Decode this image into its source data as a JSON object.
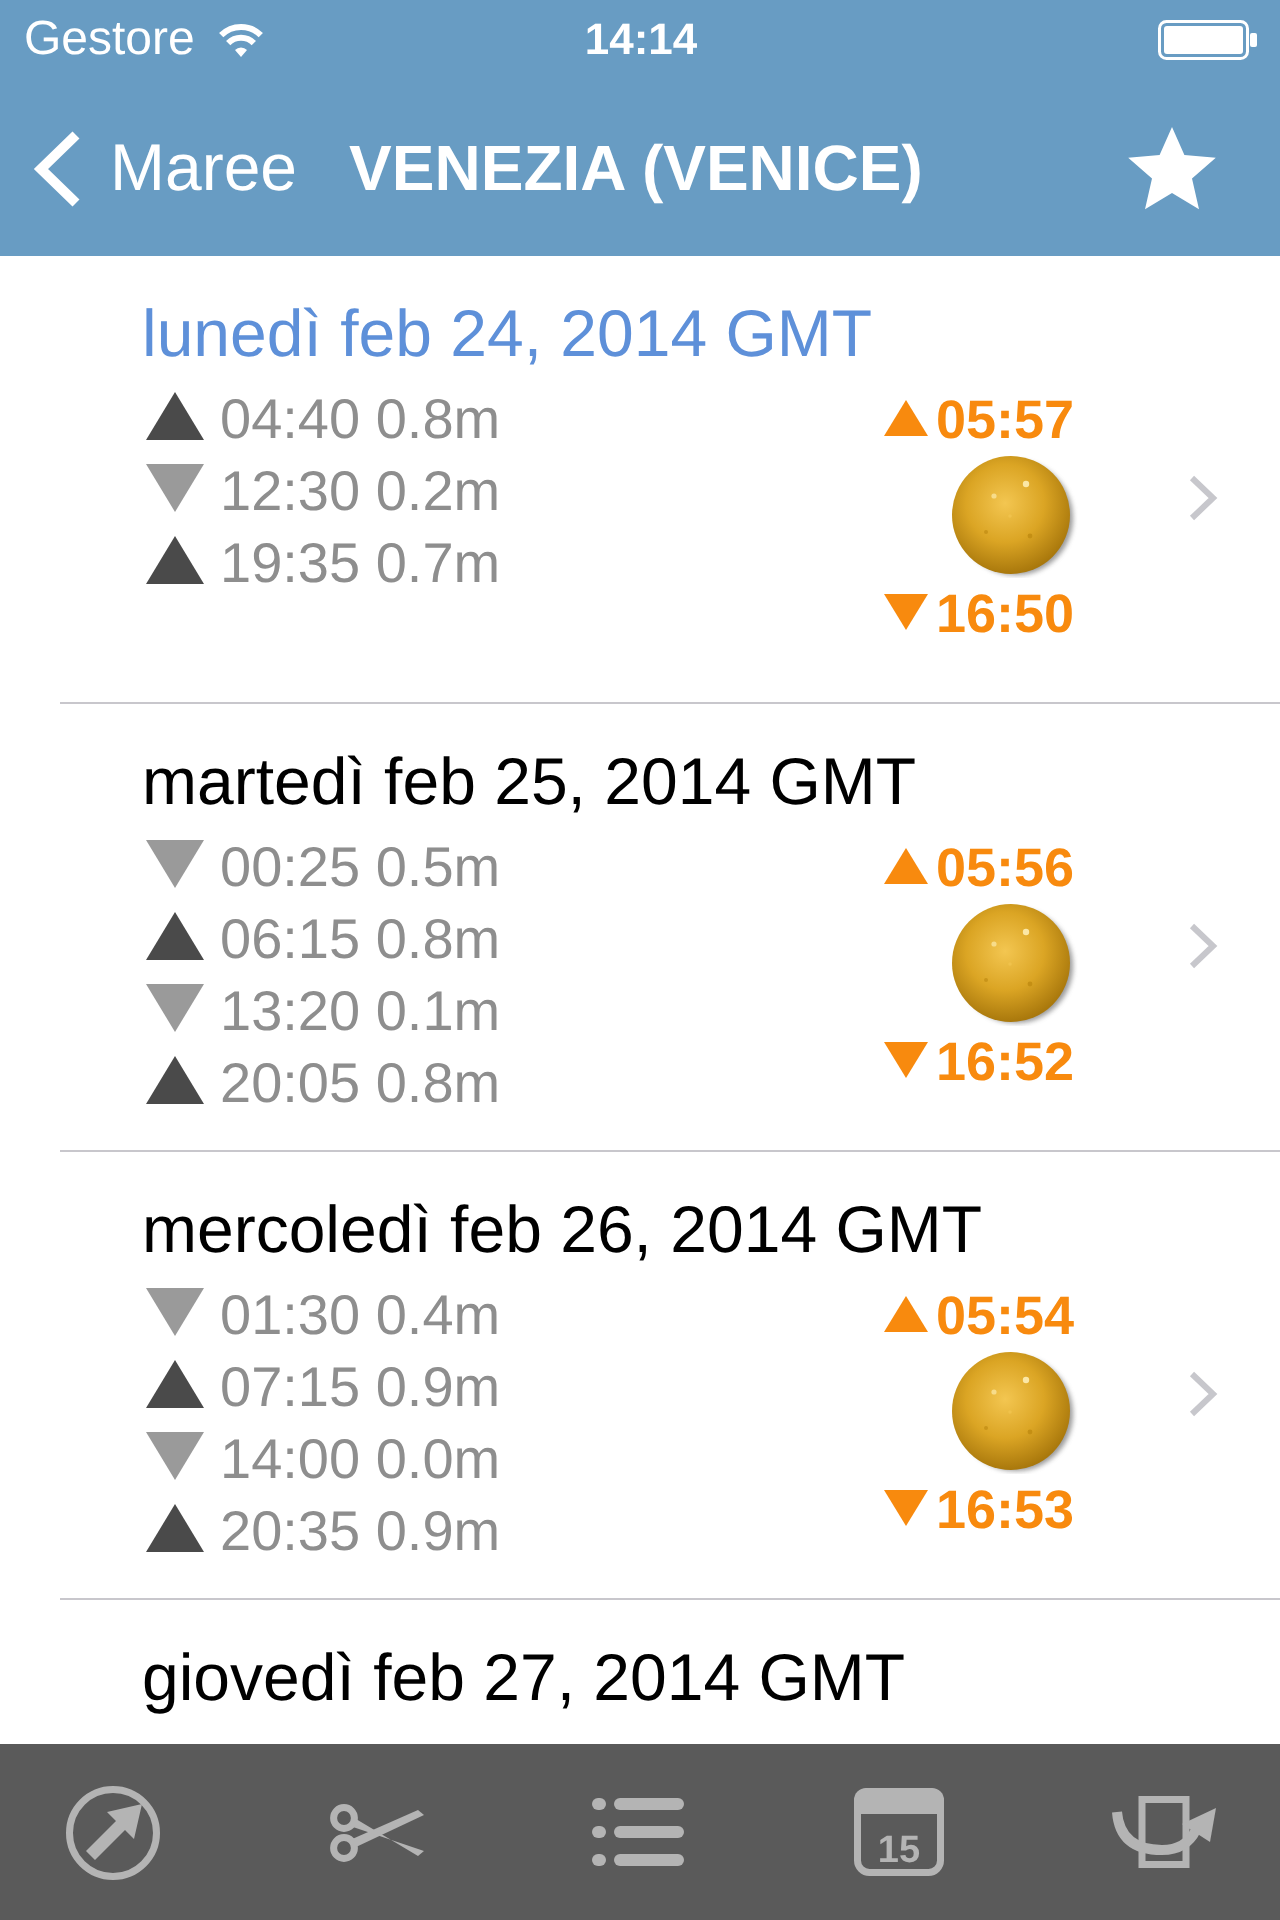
{
  "status_bar": {
    "carrier": "Gestore",
    "time": "14:14"
  },
  "nav_bar": {
    "back_label": "Maree",
    "title": "VENEZIA (VENICE)",
    "favorite": true
  },
  "days": [
    {
      "date": "lunedì feb 24, 2014 GMT",
      "today": true,
      "tides": [
        {
          "kind": "high",
          "text": "04:40 0.8m"
        },
        {
          "kind": "low",
          "text": "12:30 0.2m"
        },
        {
          "kind": "high",
          "text": "19:35 0.7m"
        }
      ],
      "sunrise": "05:57",
      "sunset": "16:50"
    },
    {
      "date": "martedì feb 25, 2014 GMT",
      "today": false,
      "tides": [
        {
          "kind": "low",
          "text": "00:25 0.5m"
        },
        {
          "kind": "high",
          "text": "06:15 0.8m"
        },
        {
          "kind": "low",
          "text": "13:20 0.1m"
        },
        {
          "kind": "high",
          "text": "20:05 0.8m"
        }
      ],
      "sunrise": "05:56",
      "sunset": "16:52"
    },
    {
      "date": "mercoledì feb 26, 2014 GMT",
      "today": false,
      "tides": [
        {
          "kind": "low",
          "text": "01:30 0.4m"
        },
        {
          "kind": "high",
          "text": "07:15 0.9m"
        },
        {
          "kind": "low",
          "text": "14:00 0.0m"
        },
        {
          "kind": "high",
          "text": "20:35 0.9m"
        }
      ],
      "sunrise": "05:54",
      "sunset": "16:53"
    },
    {
      "date": "giovedì feb 27, 2014 GMT",
      "today": false
    }
  ],
  "tab_bar": {
    "items": [
      {
        "kind": "compass"
      },
      {
        "kind": "scissors"
      },
      {
        "kind": "list"
      },
      {
        "kind": "calendar",
        "label": "15"
      },
      {
        "kind": "tray"
      }
    ]
  }
}
